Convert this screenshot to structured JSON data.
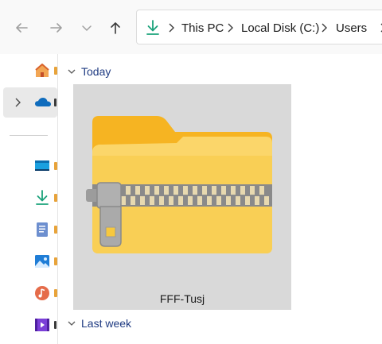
{
  "toolbar": {
    "back_icon": "back-arrow-icon",
    "forward_icon": "forward-arrow-icon",
    "recent_icon": "chevron-down-icon",
    "up_icon": "up-arrow-icon"
  },
  "address_bar": {
    "location_icon": "downloads-icon",
    "breadcrumbs": [
      "This PC",
      "Local Disk (C:)",
      "Users"
    ]
  },
  "sidebar": {
    "items": [
      {
        "icon": "home-icon",
        "color": "#e8803a"
      },
      {
        "icon": "onedrive-icon",
        "color": "#0f6cbd"
      },
      {
        "icon": "desktop-icon",
        "color": "#1a8fd6"
      },
      {
        "icon": "downloads-icon",
        "color": "#1aa27a"
      },
      {
        "icon": "documents-icon",
        "color": "#5b7fbf"
      },
      {
        "icon": "pictures-icon",
        "color": "#2d7dd2"
      },
      {
        "icon": "music-icon",
        "color": "#e0663f"
      },
      {
        "icon": "videos-icon",
        "color": "#7a3fd6"
      }
    ]
  },
  "content": {
    "groups": [
      {
        "label": "Today"
      },
      {
        "label": "Last week"
      }
    ],
    "files": [
      {
        "name": "FFF-Tusj",
        "icon": "zip-folder-icon"
      }
    ]
  },
  "colors": {
    "selection_bg": "#d9d9d9",
    "group_header": "#1f3b82",
    "folder_yellow": "#f8c845"
  }
}
